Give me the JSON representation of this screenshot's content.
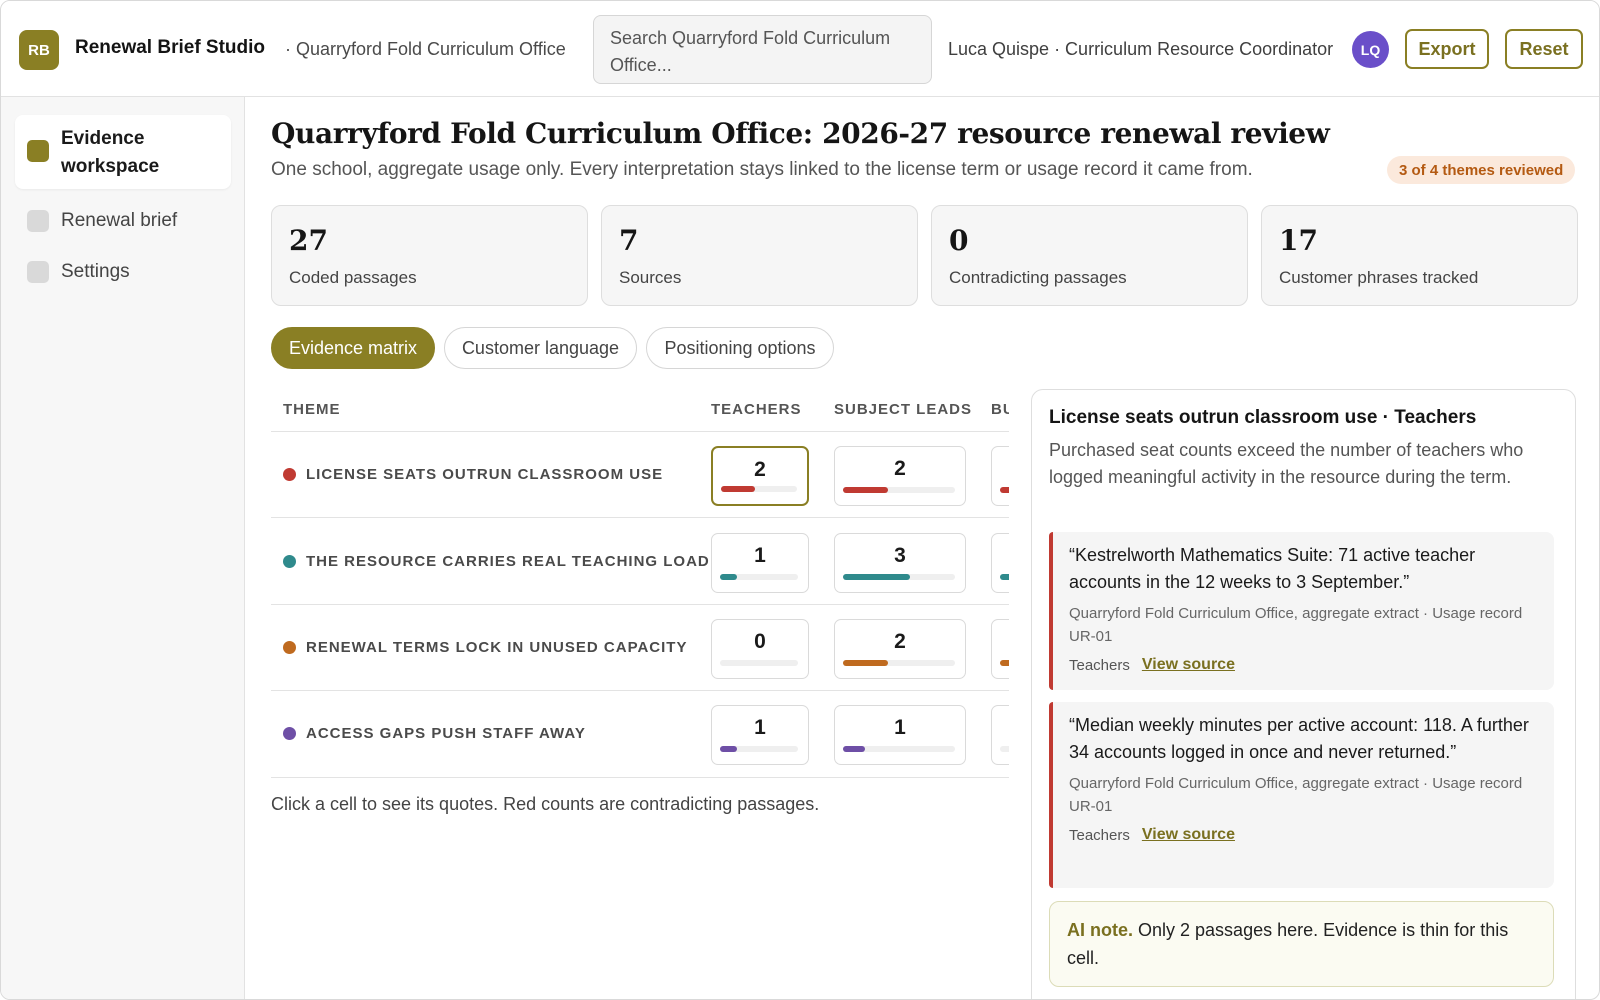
{
  "app": {
    "logo_initials": "RB",
    "title": "Renewal Brief Studio",
    "org_crumb": "· Quarryford Fold Curriculum Office",
    "search_placeholder": "Search Quarryford Fold Curriculum Office...",
    "user_label": "Luca Quispe · Curriculum Resource Coordinator",
    "user_initials": "LQ",
    "export_label": "Export",
    "reset_label": "Reset",
    "colors": {
      "brand": "#8a7f24",
      "avatar": "#6a4fc9",
      "contradicting": "#c03a32"
    }
  },
  "sidebar": {
    "items": [
      {
        "label": "Evidence workspace",
        "active": true
      },
      {
        "label": "Renewal brief",
        "active": false
      },
      {
        "label": "Settings",
        "active": false
      }
    ]
  },
  "page": {
    "title": "Quarryford Fold Curriculum Office: 2026-27 resource renewal review",
    "subtitle": "One school, aggregate usage only. Every interpretation stays linked to the license term or usage record it came from.",
    "progress_badge": "3 of 4 themes reviewed"
  },
  "stats": [
    {
      "value": "27",
      "label": "Coded passages"
    },
    {
      "value": "7",
      "label": "Sources"
    },
    {
      "value": "0",
      "label": "Contradicting passages"
    },
    {
      "value": "17",
      "label": "Customer phrases tracked"
    }
  ],
  "tabs": [
    {
      "label": "Evidence matrix",
      "active": true
    },
    {
      "label": "Customer language",
      "active": false
    },
    {
      "label": "Positioning options",
      "active": false
    }
  ],
  "matrix": {
    "columns": [
      "THEME",
      "TEACHERS",
      "SUBJECT LEADS",
      "BU"
    ],
    "rows": [
      {
        "theme": "LICENSE SEATS OUTRUN CLASSROOM USE",
        "color": "#c03a32",
        "counts": [
          "2",
          "2"
        ],
        "fill": [
          0.45,
          0.4,
          0.4
        ]
      },
      {
        "theme": "THE RESOURCE CARRIES REAL TEACHING LOAD",
        "color": "#2f8a8c",
        "counts": [
          "1",
          "3"
        ],
        "fill": [
          0.22,
          0.6,
          0.4
        ]
      },
      {
        "theme": "RENEWAL TERMS LOCK IN UNUSED CAPACITY",
        "color": "#bf6a1f",
        "counts": [
          "0",
          "2"
        ],
        "fill": [
          0.0,
          0.4,
          0.4
        ]
      },
      {
        "theme": "ACCESS GAPS PUSH STAFF AWAY",
        "color": "#6e4fa6",
        "counts": [
          "1",
          "1"
        ],
        "fill": [
          0.22,
          0.2,
          0.0
        ]
      }
    ],
    "hint": "Click a cell to see its quotes. Red counts are contradicting passages."
  },
  "detail": {
    "title": "License seats outrun classroom use · Teachers",
    "description": "Purchased seat counts exceed the number of teachers who logged meaningful activity in the resource during the term.",
    "quotes": [
      {
        "text": "“Kestrelworth Mathematics Suite: 71 active teacher accounts in the 12 weeks to 3 September.”",
        "source": "Quarryford Fold Curriculum Office, aggregate extract · Usage record UR-01",
        "segment": "Teachers",
        "link": "View source"
      },
      {
        "text": "“Median weekly minutes per active account: 118. A further 34 accounts logged in once and never returned.”",
        "source": "Quarryford Fold Curriculum Office, aggregate extract · Usage record UR-01",
        "segment": "Teachers",
        "link": "View source"
      }
    ],
    "ai_label": "AI note.",
    "ai_text": "Only 2 passages here. Evidence is thin for this cell."
  }
}
